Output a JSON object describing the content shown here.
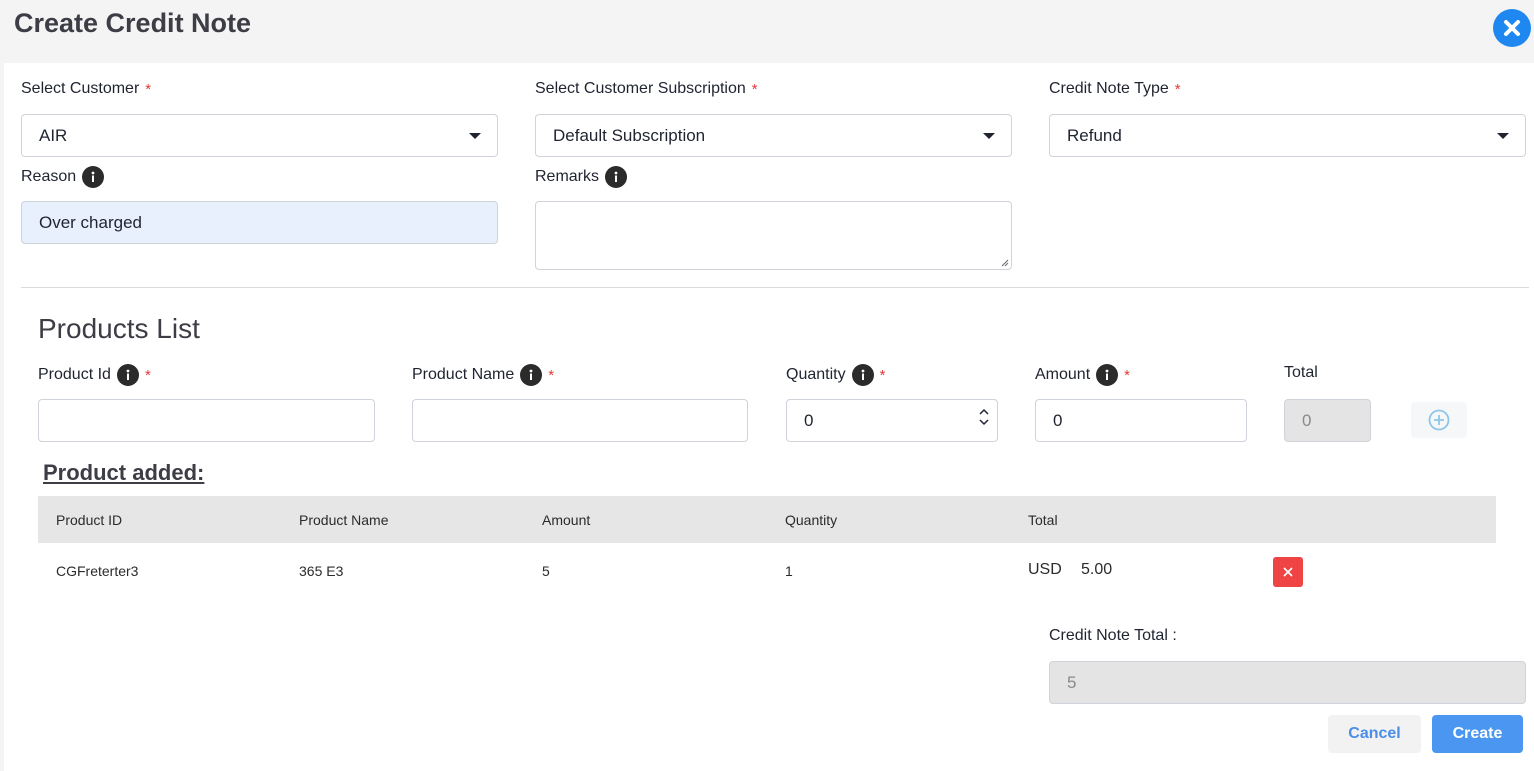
{
  "dialog": {
    "title": "Create Credit Note",
    "close_icon": "close-circle-icon",
    "accent_color": "#1e88f0"
  },
  "form": {
    "customer": {
      "label": "Select Customer",
      "required_mark": "*",
      "value": "AIR"
    },
    "subscription": {
      "label": "Select Customer Subscription",
      "required_mark": "*",
      "value": "Default Subscription"
    },
    "note_type": {
      "label": "Credit Note Type",
      "required_mark": "*",
      "value": "Refund"
    },
    "reason": {
      "label": "Reason",
      "value": "Over charged"
    },
    "remarks": {
      "label": "Remarks",
      "value": ""
    }
  },
  "products": {
    "title": "Products List",
    "product_id": {
      "label": "Product Id",
      "required_mark": "*",
      "value": ""
    },
    "product_name": {
      "label": "Product Name",
      "required_mark": "*",
      "value": ""
    },
    "quantity": {
      "label": "Quantity",
      "required_mark": "*",
      "value": "0"
    },
    "amount": {
      "label": "Amount",
      "required_mark": "*",
      "value": "0"
    },
    "total": {
      "label": "Total",
      "value": "0"
    },
    "add_icon": "plus-circle-icon"
  },
  "added": {
    "heading": "Product added:",
    "columns": [
      "Product ID",
      "Product Name",
      "Amount",
      "Quantity",
      "Total"
    ],
    "rows": [
      {
        "product_id": "CGFreterter3",
        "product_name": "365 E3",
        "amount": "5",
        "quantity": "1",
        "currency": "USD",
        "total": "5.00"
      }
    ]
  },
  "summary": {
    "label": "Credit Note Total :",
    "value": "5"
  },
  "actions": {
    "cancel": "Cancel",
    "create": "Create"
  },
  "colors": {
    "required": "#e53935",
    "delete": "#ef4444",
    "primary_button": "#4a96f0"
  }
}
